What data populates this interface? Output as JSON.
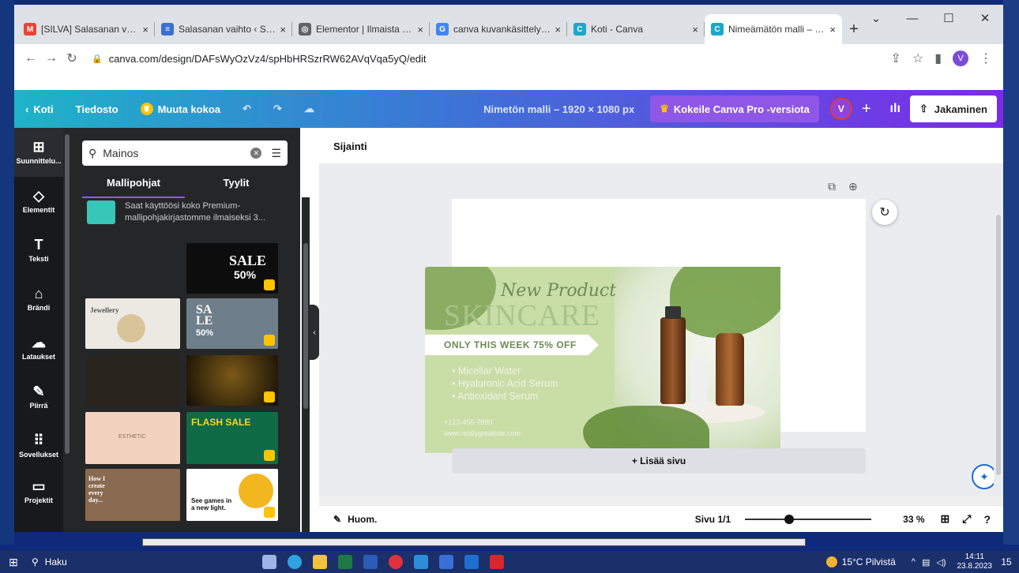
{
  "browser": {
    "tabs": [
      {
        "title": "[SILVA] Salasanan vaihto -",
        "color": "#ea4335",
        "glyph": "M"
      },
      {
        "title": "Salasanan vaihto ‹ SILVA –",
        "color": "#3b6fd1",
        "glyph": "≡"
      },
      {
        "title": "Elementor | Ilmaista mainc",
        "color": "#5f6368",
        "glyph": "◎"
      },
      {
        "title": "canva kuvankäsittely – Goo",
        "color": "#4285f4",
        "glyph": "G"
      },
      {
        "title": "Koti - Canva",
        "color": "#19a9c9",
        "glyph": "C"
      },
      {
        "title": "Nimeämätön malli – 1920",
        "color": "#19a9c9",
        "glyph": "C"
      }
    ],
    "new_tab": "+",
    "url": "canva.com/design/DAFsWyOzVz4/spHbHRSzrRW62AVqVqa5yQ/edit",
    "profile": "V"
  },
  "header": {
    "back": "Koti",
    "file": "Tiedosto",
    "resize": "Muuta kokoa",
    "title": "Nimetön malli – 1920 × 1080 px",
    "pro": "Kokeile Canva Pro -versiota",
    "avatar": "V",
    "share": "Jakaminen"
  },
  "rail": [
    {
      "label": "Suunnittelu...",
      "icon": "⊞"
    },
    {
      "label": "Elementit",
      "icon": "◇"
    },
    {
      "label": "Teksti",
      "icon": "T"
    },
    {
      "label": "Brändi",
      "icon": "⌂"
    },
    {
      "label": "Lataukset",
      "icon": "☁"
    },
    {
      "label": "Piirrä",
      "icon": "✎"
    },
    {
      "label": "Sovellukset",
      "icon": "⠿"
    }
  ],
  "rail_projects": {
    "label": "Projektit",
    "icon": "▭"
  },
  "panel": {
    "search_value": "Mainos",
    "tab_templates": "Mallipohjat",
    "tab_styles": "Tyylit",
    "promo": "Saat käyttöösi koko Premium-mallipohjakirjastomme ilmaiseksi 3..."
  },
  "thumbs": {
    "sale": "SALE",
    "pct": "50%",
    "jewellery": "Jewellery",
    "sale_sa": "SA",
    "sale_le": "LE",
    "esthetic": "ESTHETIC",
    "flash": "FLASH SALE",
    "howi": "How I create every day...",
    "games": "See games in a new light."
  },
  "editor": {
    "toolbar": "Sijainti",
    "add_page": "+ Lisää sivu",
    "notes": "Huom.",
    "page": "Sivu 1/1",
    "zoom": "33 %"
  },
  "ad": {
    "new_product": "New Product",
    "skincare": "SKINCARE",
    "offer": "ONLY THIS WEEK 75% OFF",
    "items": [
      "Micellar Water",
      "Hyaluronic Acid Serum",
      "Antioxidant Serum"
    ],
    "phone": "+123-456-7890",
    "web": "www.reallygreatsite.com"
  },
  "taskbar": {
    "search": "Haku",
    "weather": "15°C Pilvistä",
    "time": "14:11",
    "date": "23.8.2023",
    "notif": "15"
  }
}
